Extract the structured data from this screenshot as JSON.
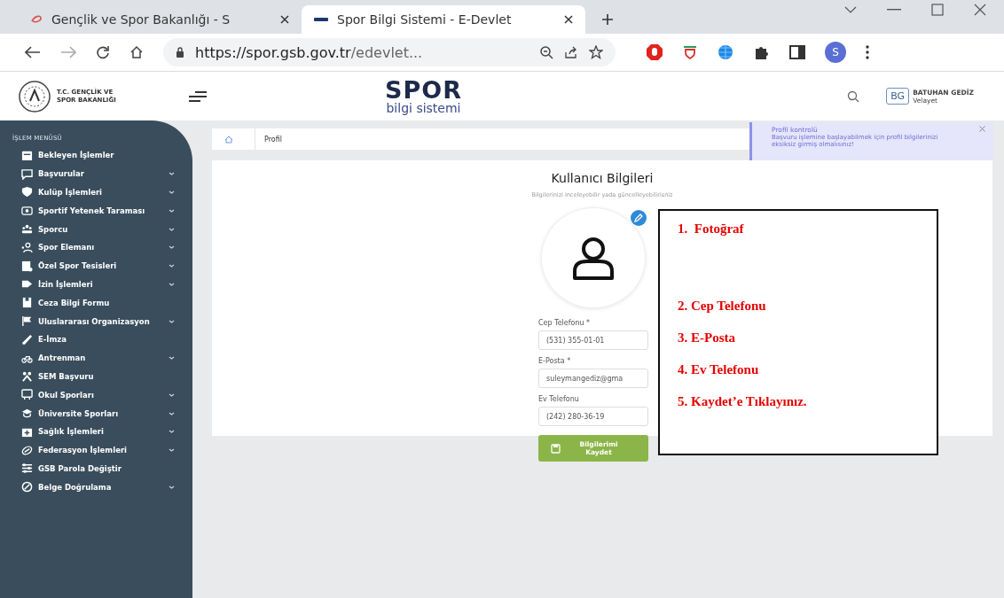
{
  "browser": {
    "tabs": [
      {
        "title": "Gençlik ve Spor Bakanlığı - S",
        "selected": false
      },
      {
        "title": "Spor Bilgi Sistemi - E-Devlet",
        "selected": true
      }
    ],
    "url_host": "https://spor.gsb.gov.tr",
    "url_path": "/edevlet...",
    "profile_initial": "S"
  },
  "header": {
    "ministry_line_1": "T.C. GENÇLİK VE",
    "ministry_line_2": "SPOR BAKANLIĞI",
    "brand": "SPOR",
    "brand_subtitle": "bilgi sistemi",
    "user_initials": "BG",
    "user_name": "BATUHAN GEDİZ",
    "user_role": "Velayet"
  },
  "sidebar": {
    "heading": "İŞLEM MENÜSÜ",
    "items": [
      {
        "label": "Bekleyen İşlemler",
        "has_submenu": false
      },
      {
        "label": "Başvurular",
        "has_submenu": true
      },
      {
        "label": "Kulüp İşlemleri",
        "has_submenu": true
      },
      {
        "label": "Sportif Yetenek Taraması",
        "has_submenu": true
      },
      {
        "label": "Sporcu",
        "has_submenu": true
      },
      {
        "label": "Spor Elemanı",
        "has_submenu": true
      },
      {
        "label": "Özel Spor Tesisleri",
        "has_submenu": true
      },
      {
        "label": "İzin İşlemleri",
        "has_submenu": true
      },
      {
        "label": "Ceza Bilgi Formu",
        "has_submenu": false
      },
      {
        "label": "Uluslararası Organizasyon",
        "has_submenu": true
      },
      {
        "label": "E-İmza",
        "has_submenu": false
      },
      {
        "label": "Antrenman",
        "has_submenu": true
      },
      {
        "label": "SEM Başvuru",
        "has_submenu": false
      },
      {
        "label": "Okul Sporları",
        "has_submenu": true
      },
      {
        "label": "Üniversite Sporları",
        "has_submenu": true
      },
      {
        "label": "Sağlık İşlemleri",
        "has_submenu": true
      },
      {
        "label": "Federasyon İşlemleri",
        "has_submenu": true
      },
      {
        "label": "GSB Parola Değiştir",
        "has_submenu": false
      },
      {
        "label": "Belge Doğrulama",
        "has_submenu": true
      }
    ]
  },
  "breadcrumb": "Profil",
  "notification": {
    "title": "Profil kontrolü",
    "message": "Başvuru işlemine başlayabilmek için profil bilgilerinizi eksiksiz girmiş olmalısınız!"
  },
  "profile_card": {
    "title": "Kullanıcı Bilgileri",
    "subtitle": "Bilgilerinizi inceleyebilir yada güncelleyebilirisniz",
    "fields": [
      {
        "label": "Cep Telefonu *",
        "value": "(531) 355-01-01"
      },
      {
        "label": "E-Posta *",
        "value": "suleymangediz@gma"
      },
      {
        "label": "Ev Telefonu",
        "value": "(242) 280-36-19"
      }
    ],
    "save_button": "Bilgilerimi Kaydet"
  },
  "annotation": [
    "1.  Fotoğraf",
    "2. Cep Telefonu",
    "3. E-Posta",
    "4. Ev Telefonu",
    "5. Kaydet’e Tıklayınız."
  ]
}
